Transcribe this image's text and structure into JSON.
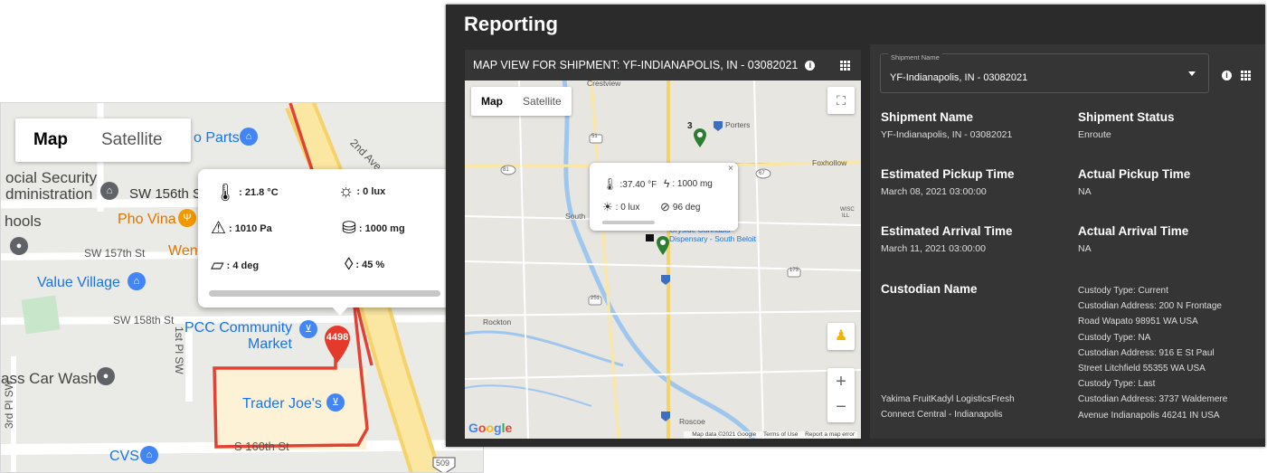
{
  "left_map": {
    "toggle": {
      "map_label": "Map",
      "satellite_label": "Satellite"
    },
    "labels": {
      "social_security_1": "ocial Security",
      "social_security_2": "dministration",
      "schools": "hools",
      "sw156": "SW 156th S",
      "pho": "Pho Vina",
      "sw157": "SW 157th St",
      "wen": "Wen",
      "value_village": "Value Village",
      "sw158": "SW 158th St",
      "pcc_1": "PCC Community",
      "pcc_2": "Market",
      "car_wash": "ass Car Wash",
      "trader_joes": "Trader Joe's",
      "cvs": "CVS",
      "s160": "S 160th St",
      "parts": "o Parts",
      "second_ave": "2nd Ave",
      "first_pl": "1st Pl SW",
      "third_pl": "3rd Pl SW",
      "marker": "4498",
      "route_shield": "509"
    },
    "popup": {
      "temperature": ": 21.8 °C",
      "light": ": 0 lux",
      "pressure": ": 1010 Pa",
      "weight": ": 1000 mg",
      "tilt": ": 4 deg",
      "humidity": ": 45 %"
    }
  },
  "report": {
    "title": "Reporting",
    "map_header": "MAP VIEW FOR SHIPMENT: YF-INDIANAPOLIS, IN - 03082021",
    "map_toggle": {
      "map_label": "Map",
      "satellite_label": "Satellite"
    },
    "map_labels": {
      "crestview": "Crestview",
      "porters": "Porters",
      "foxhollow": "Foxhollow",
      "south": "South",
      "cannabis_1": "Oryside Cannabis",
      "cannabis_2": "Dispensary - South Beloit",
      "rockton": "Rockton",
      "roscoe": "Roscoe",
      "wisc": "WISC",
      "ill": "ILL",
      "num3": "3",
      "r51": "51",
      "r81": "81",
      "r67": "67",
      "r251": "251",
      "r75": "75",
      "r2": "2",
      "r173": "173"
    },
    "popup": {
      "temperature": ":37.40 °F",
      "weight": ": 1000 mg",
      "light": ": 0 lux",
      "tilt": "96 deg",
      "close": "×"
    },
    "attribution": {
      "data": "Map data ©2021 Google",
      "terms": "Terms of Use",
      "report": "Report a map error",
      "logo": [
        "G",
        "o",
        "o",
        "g",
        "l",
        "e"
      ]
    },
    "details": {
      "select_label": "Shipment Name",
      "select_value": "YF-Indianapolis, IN - 03082021",
      "shipment_name_h": "Shipment Name",
      "shipment_name_v": "YF-Indianapolis, IN - 03082021",
      "shipment_status_h": "Shipment Status",
      "shipment_status_v": "Enroute",
      "est_pickup_h": "Estimated Pickup Time",
      "est_pickup_v": "March 08, 2021 03:00:00",
      "act_pickup_h": "Actual Pickup Time",
      "act_pickup_v": "NA",
      "est_arrival_h": "Estimated Arrival Time",
      "est_arrival_v": "March 11, 2021 03:00:00",
      "act_arrival_h": "Actual Arrival Time",
      "act_arrival_v": "NA",
      "custodian_h": "Custodian Name",
      "custody_lines": [
        "Custody Type: Current",
        "Custodian Address: 200 N Frontage",
        "Road Wapato 98951 WA USA",
        "Custody Type: NA",
        "Custodian Address: 916 E St Paul",
        "Street Litchfield 55355 WA USA",
        "Custody Type: Last",
        "Custodian Address: 3737 Waldemere",
        "Avenue Indianapolis 46241 IN USA"
      ],
      "custodian_names_1": "Yakima FruitKadyl LogisticsFresh",
      "custodian_names_2": "Connect Central - Indianapolis"
    }
  }
}
